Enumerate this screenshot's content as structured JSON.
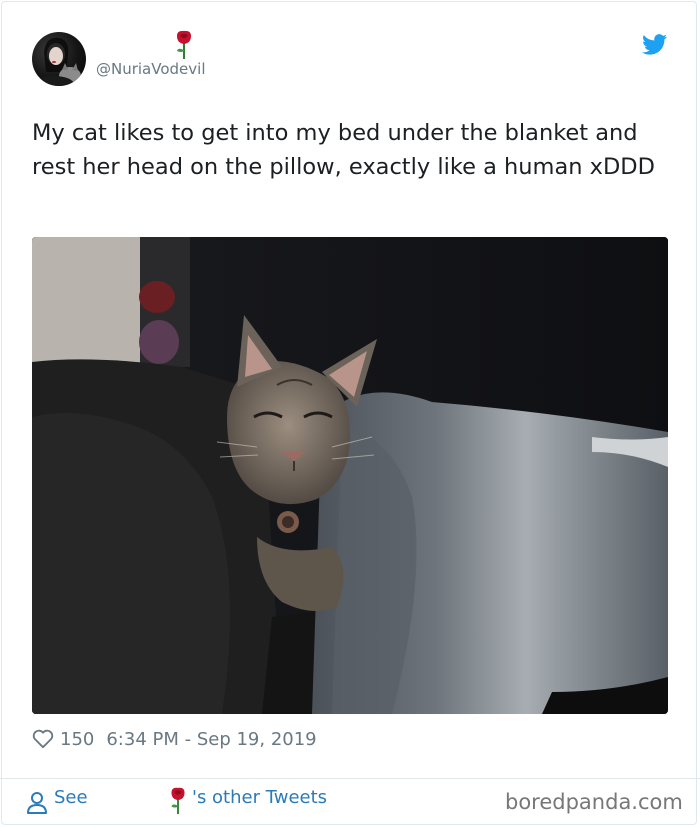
{
  "tweet": {
    "handle": "@NuriaVodevil",
    "text": "My cat likes to get into my bed under the blanket and rest her head on the pillow, exactly like a human xDDD",
    "likes": "150",
    "timestamp": "6:34 PM - Sep 19, 2019"
  },
  "footer": {
    "see_label": "See",
    "other_tweets_label": "'s other Tweets",
    "brand": "boredpanda.com"
  },
  "icons": {
    "rose": "rose-icon",
    "twitter": "twitter-bird-icon",
    "heart": "heart-icon",
    "person": "person-icon"
  },
  "colors": {
    "link": "#2b7bb9",
    "twitter_blue": "#1da1f2",
    "muted": "#697882"
  }
}
